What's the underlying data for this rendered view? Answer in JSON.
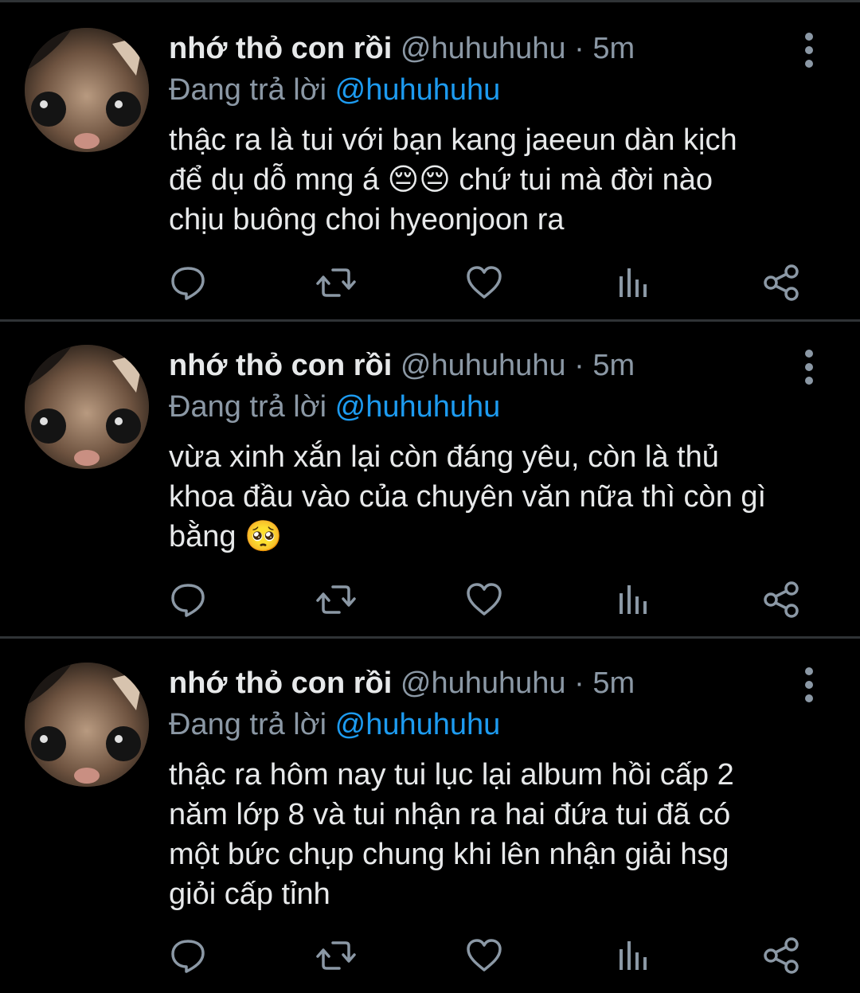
{
  "colors": {
    "background": "#000000",
    "primary_text": "#e7e9ea",
    "secondary_text": "#8b98a5",
    "link": "#1d9bf0",
    "divider": "#2f3336"
  },
  "icons": {
    "reply": "reply-icon",
    "retweet": "retweet-icon",
    "like": "heart-icon",
    "analytics": "analytics-icon",
    "share": "share-icon",
    "more": "more-vertical-icon"
  },
  "tweets": [
    {
      "display_name": "nhớ thỏ con rồi",
      "handle": "@huhuhuhu",
      "separator": "·",
      "time": "5m",
      "reply_prefix": "Đang trả lời",
      "reply_to": "@huhuhuhu",
      "text": "thậc ra là tui với bạn kang jaeeun dàn kịch\nđể dụ dỗ mng á 😔😔 chứ tui mà đời nào\nchịu buông choi hyeonjoon ra"
    },
    {
      "display_name": "nhớ thỏ con rồi",
      "handle": "@huhuhuhu",
      "separator": "·",
      "time": "5m",
      "reply_prefix": "Đang trả lời",
      "reply_to": "@huhuhuhu",
      "text": "vừa xinh xắn lại còn đáng yêu, còn là thủ\nkhoa đầu vào của chuyên văn nữa thì còn gì\nbằng 🥺"
    },
    {
      "display_name": "nhớ thỏ con rồi",
      "handle": "@huhuhuhu",
      "separator": "·",
      "time": "5m",
      "reply_prefix": "Đang trả lời",
      "reply_to": "@huhuhuhu",
      "text": "thậc ra hôm nay tui lục lại album hồi cấp 2\nnăm lớp 8 và tui nhận ra hai đứa tui đã có\nmột bức chụp chung khi lên nhận giải hsg\ngiỏi cấp tỉnh"
    }
  ]
}
